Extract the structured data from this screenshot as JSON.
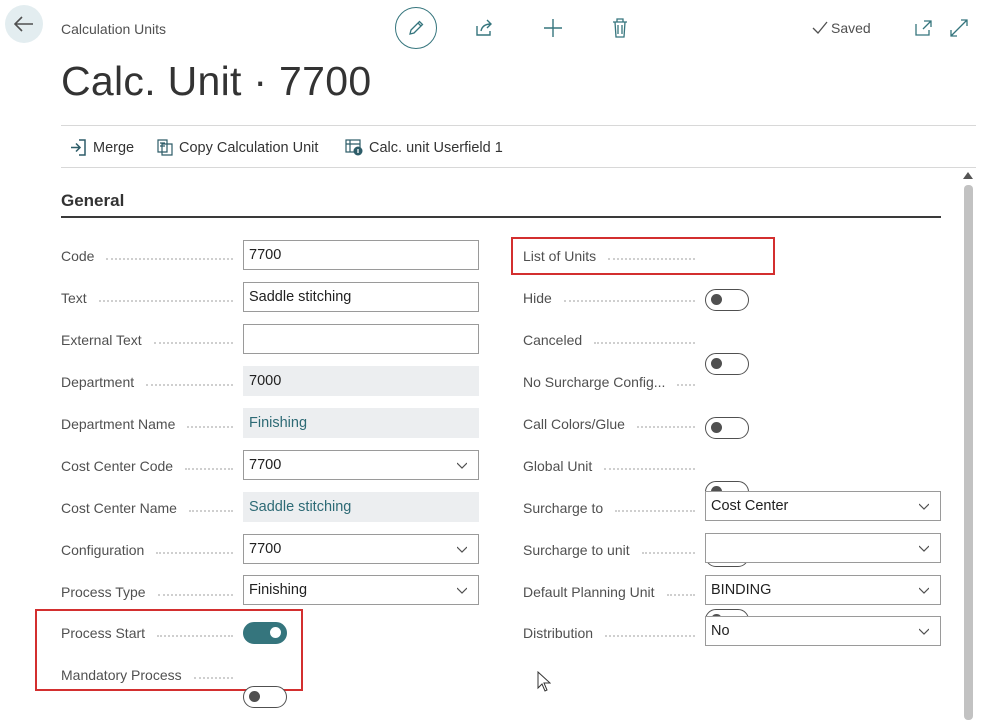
{
  "header": {
    "breadcrumb": "Calculation Units",
    "title": "Calc. Unit · 7700",
    "status": "Saved"
  },
  "icons": {
    "back": "arrow-left-icon",
    "edit": "pencil-icon",
    "share": "share-icon",
    "new": "plus-icon",
    "delete": "trash-icon",
    "saved": "checkmark-icon",
    "open_new_window": "open-in-new-window-icon",
    "expand": "expand-icon"
  },
  "actions": {
    "merge": "Merge",
    "copy": "Copy Calculation Unit",
    "userfield": "Calc. unit Userfield 1"
  },
  "section": {
    "title": "General"
  },
  "left_fields": {
    "code": {
      "label": "Code",
      "value": "7700"
    },
    "text": {
      "label": "Text",
      "value": "Saddle stitching"
    },
    "external_text": {
      "label": "External Text",
      "value": ""
    },
    "department": {
      "label": "Department",
      "value": "7000"
    },
    "department_name": {
      "label": "Department Name",
      "value": "Finishing"
    },
    "cost_center_code": {
      "label": "Cost Center Code",
      "value": "7700"
    },
    "cost_center_name": {
      "label": "Cost Center Name",
      "value": "Saddle stitching"
    },
    "configuration": {
      "label": "Configuration",
      "value": "7700"
    },
    "process_type": {
      "label": "Process Type",
      "value": "Finishing"
    },
    "process_start": {
      "label": "Process Start",
      "on": true
    },
    "mandatory_process": {
      "label": "Mandatory Process",
      "on": false
    }
  },
  "right_fields": {
    "list_of_units": {
      "label": "List of Units",
      "on": false
    },
    "hide": {
      "label": "Hide",
      "on": false
    },
    "canceled": {
      "label": "Canceled",
      "on": false
    },
    "no_surcharge": {
      "label": "No Surcharge Config...",
      "on": false
    },
    "call_colors": {
      "label": "Call Colors/Glue",
      "on": false
    },
    "global_unit": {
      "label": "Global Unit",
      "on": false
    },
    "surcharge_to": {
      "label": "Surcharge to",
      "value": "Cost Center"
    },
    "surcharge_to_unit": {
      "label": "Surcharge to unit",
      "value": ""
    },
    "default_planning_unit": {
      "label": "Default Planning Unit",
      "value": "BINDING"
    },
    "distribution": {
      "label": "Distribution",
      "value": "No"
    }
  },
  "colors": {
    "accent": "#35757d",
    "highlight": "#d32f2f"
  }
}
